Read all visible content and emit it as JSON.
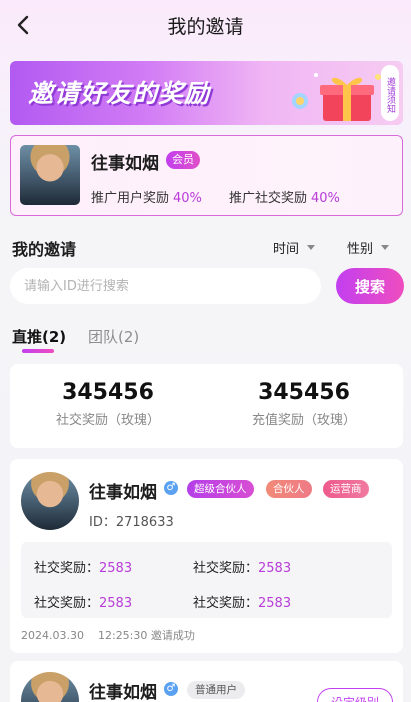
{
  "header": {
    "title": "我的邀请"
  },
  "banner": {
    "text": "邀请好友的奖励",
    "rules_label": "邀请须知"
  },
  "member": {
    "name": "往事如烟",
    "badge": "会员",
    "user_reward_label": "推广用户奖励",
    "user_reward_value": "40%",
    "social_reward_label": "推广社交奖励",
    "social_reward_value": "40%"
  },
  "invitations": {
    "title": "我的邀请",
    "filters": [
      "时间",
      "性别"
    ],
    "search_placeholder": "请输入ID进行搜索",
    "search_button": "搜索",
    "tabs": [
      "直推(2)",
      "团队(2)"
    ]
  },
  "stats": [
    {
      "value": "345456",
      "label": "社交奖励（玫瑰）"
    },
    {
      "value": "345456",
      "label": "充值奖励（玫瑰）"
    }
  ],
  "invite_list": [
    {
      "name": "往事如烟",
      "gender": "♂",
      "tags": [
        "超级合伙人",
        "合伙人",
        "运营商"
      ],
      "id_text": "ID：2718633",
      "rewards": [
        {
          "label": "社交奖励：",
          "value": "2583"
        },
        {
          "label": "社交奖励：",
          "value": "2583"
        },
        {
          "label": "社交奖励：",
          "value": "2583"
        },
        {
          "label": "社交奖励：",
          "value": "2583"
        }
      ],
      "date": "2024.03.30",
      "time": "12:25:30",
      "status": "邀请成功"
    },
    {
      "name": "往事如烟",
      "gender": "♂",
      "tags": [
        "普通用户"
      ],
      "action": "设定级别"
    }
  ],
  "colors": {
    "accent": "#c23ff0",
    "accent_pink": "#ef4dbf",
    "value_purple": "#b93cd9"
  }
}
